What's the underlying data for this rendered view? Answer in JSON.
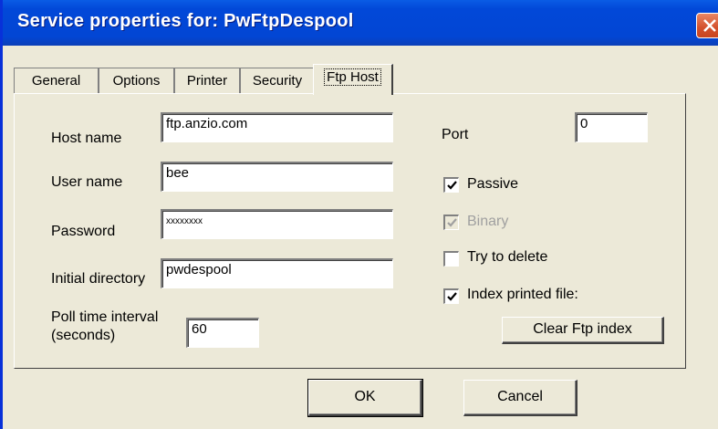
{
  "window": {
    "title": "Service properties for: PwFtpDespool"
  },
  "tabs": [
    {
      "label": "General"
    },
    {
      "label": "Options"
    },
    {
      "label": "Printer"
    },
    {
      "label": "Security"
    },
    {
      "label": "Ftp Host"
    }
  ],
  "active_tab": "Ftp Host",
  "form": {
    "host_name": {
      "label": "Host name",
      "value": "ftp.anzio.com"
    },
    "user_name": {
      "label": "User name",
      "value": "bee"
    },
    "password": {
      "label": "Password",
      "value": "xxxxxxxx"
    },
    "initial_directory": {
      "label": "Initial directory",
      "value": "pwdespool"
    },
    "poll_time": {
      "label_line1": "Poll time interval",
      "label_line2": "(seconds)",
      "value": "60"
    },
    "port": {
      "label": "Port",
      "value": "0"
    }
  },
  "checkboxes": {
    "passive": {
      "label": "Passive",
      "checked": true,
      "enabled": true
    },
    "binary": {
      "label": "Binary",
      "checked": true,
      "enabled": false
    },
    "try_delete": {
      "label": "Try to delete",
      "checked": false,
      "enabled": true
    },
    "index_printed": {
      "label": "Index printed file:",
      "checked": true,
      "enabled": true
    }
  },
  "buttons": {
    "clear_ftp_index": "Clear Ftp index",
    "ok": "OK",
    "cancel": "Cancel"
  },
  "colors": {
    "titlebar": "#0246d4",
    "face": "#ece9d8",
    "close": "#d3502c"
  }
}
